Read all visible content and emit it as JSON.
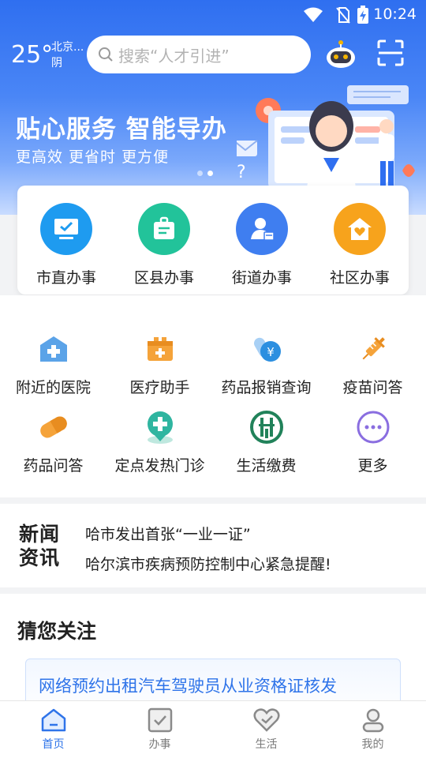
{
  "status_bar": {
    "time": "10:24"
  },
  "header": {
    "temperature": "25°",
    "city": "北京...",
    "weather": "阴",
    "search_placeholder": "搜索“人才引进”"
  },
  "banner": {
    "slogan": "贴心服务 智能导办",
    "subtitle": "更高效 更省时 更方便"
  },
  "primary_services": [
    {
      "label": "市直办事",
      "icon": "monitor-check-icon",
      "color": "#1e9bf0"
    },
    {
      "label": "区县办事",
      "icon": "briefcase-doc-icon",
      "color": "#22c39a"
    },
    {
      "label": "街道办事",
      "icon": "person-card-icon",
      "color": "#3f7ef0"
    },
    {
      "label": "社区办事",
      "icon": "house-heart-icon",
      "color": "#f7a31c"
    }
  ],
  "services": [
    {
      "label": "附近的医院",
      "icon": "hospital-icon"
    },
    {
      "label": "医疗助手",
      "icon": "medical-kit-icon"
    },
    {
      "label": "药品报销查询",
      "icon": "medicine-yuan-icon"
    },
    {
      "label": "疫苗问答",
      "icon": "vaccine-syringe-icon"
    },
    {
      "label": "药品问答",
      "icon": "pill-icon"
    },
    {
      "label": "定点发热门诊",
      "icon": "clinic-location-icon"
    },
    {
      "label": "生活缴费",
      "icon": "payment-icon"
    },
    {
      "label": "更多",
      "icon": "more-icon"
    }
  ],
  "news": {
    "logo_line1": "新闻",
    "logo_line2": "资讯",
    "items": [
      "哈市发出首张“一业一证”",
      "哈尔滨市疾病预防控制中心紧急提醒!"
    ]
  },
  "recommend": {
    "title": "猜您关注",
    "items": [
      "网络预约出租汽车驾驶员从业资格证核发"
    ]
  },
  "tabbar": [
    {
      "label": "首页",
      "icon": "home-icon",
      "active": true
    },
    {
      "label": "办事",
      "icon": "checkbox-icon",
      "active": false
    },
    {
      "label": "生活",
      "icon": "heart-check-icon",
      "active": false
    },
    {
      "label": "我的",
      "icon": "person-icon",
      "active": false
    }
  ]
}
